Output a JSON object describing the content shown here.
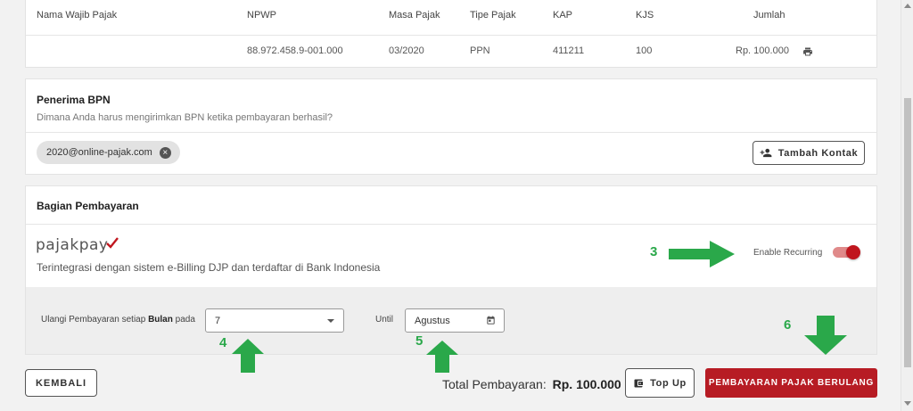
{
  "table": {
    "headers": [
      "Nama Wajib Pajak",
      "NPWP",
      "Masa Pajak",
      "Tipe Pajak",
      "KAP",
      "KJS",
      "Jumlah"
    ],
    "row": {
      "nama": "",
      "npwp": "88.972.458.9-001.000",
      "masa": "03/2020",
      "tipe": "PPN",
      "kap": "411211",
      "kjs": "100",
      "jumlah": "Rp. 100.000"
    },
    "print_icon": "printer-icon"
  },
  "penerima": {
    "title": "Penerima BPN",
    "subtitle": "Dimana Anda harus mengirimkan BPN ketika pembayaran berhasil?",
    "email_chip": "2020@online-pajak.com",
    "remove_icon": "close-circle-icon",
    "add_contact_icon": "person-add-icon",
    "add_contact_label": "Tambah Kontak"
  },
  "pembayaran": {
    "title": "Bagian Pembayaran",
    "logo_text": "pajakpay",
    "description": "Terintegrasi dengan sistem e-Billing DJP dan terdaftar di Bank Indonesia",
    "recurring_label": "Enable Recurring",
    "recurring_enabled": true,
    "repeat_label_prefix": "Ulangi Pembayaran setiap",
    "repeat_label_bold": "Bulan",
    "repeat_label_suffix": "pada",
    "repeat_value": "7",
    "until_label": "Until",
    "until_value": "Agustus"
  },
  "annotations": {
    "step3": "3",
    "step4": "4",
    "step5": "5",
    "step6": "6",
    "arrow_color": "#2aa84a"
  },
  "footer": {
    "back_label": "KEMBALI",
    "total_label": "Total Pembayaran:",
    "total_value": "Rp. 100.000",
    "topup_icon": "wallet-icon",
    "topup_label": "Top Up",
    "submit_label": "PEMBAYARAN PAJAK BERULANG",
    "accent_color": "#b71c24"
  }
}
